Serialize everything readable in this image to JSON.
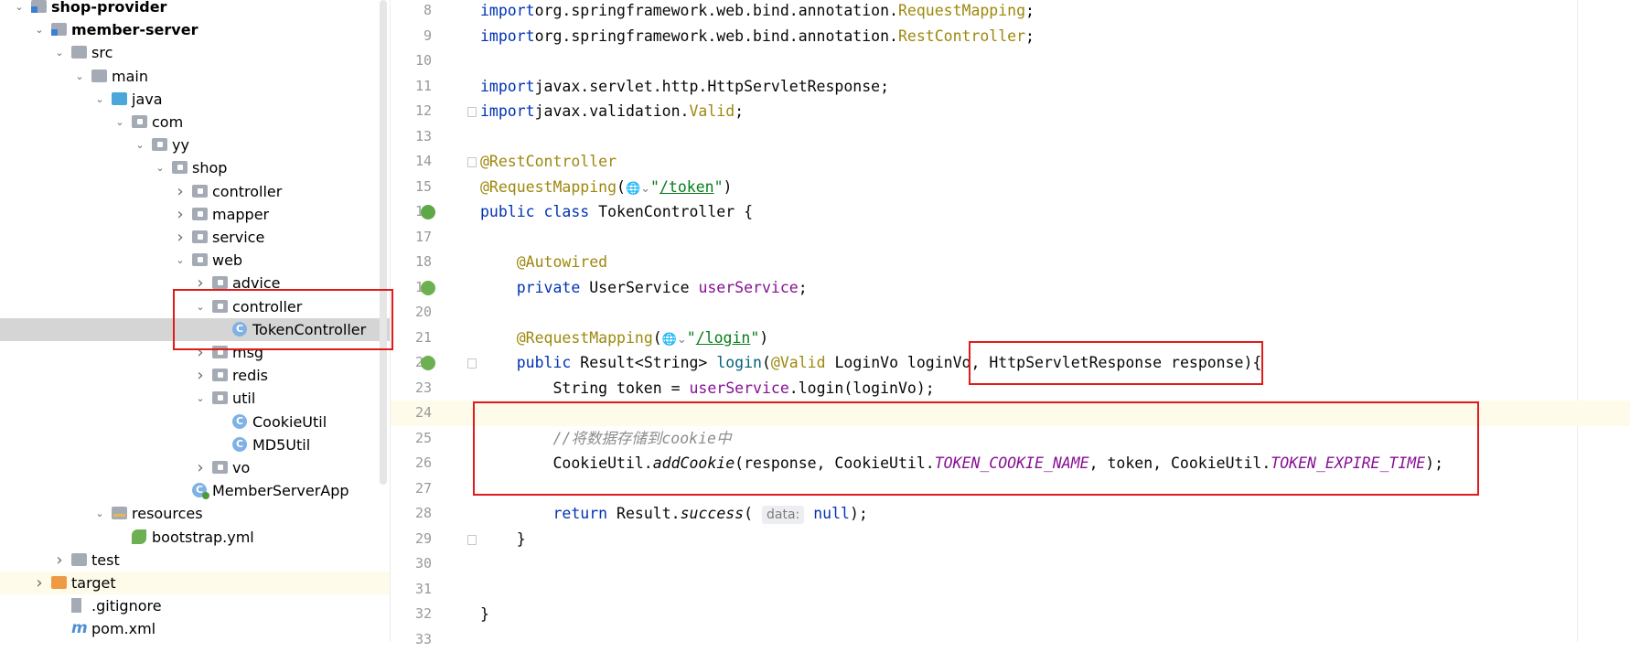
{
  "project_tree": {
    "items": [
      {
        "label": "shop-provider",
        "icon": "module-folder-icon",
        "arrow": "expanded",
        "bold": true
      },
      {
        "label": "member-server",
        "icon": "module-folder-icon",
        "arrow": "expanded",
        "bold": true
      },
      {
        "label": "src",
        "icon": "folder-icon",
        "arrow": "expanded"
      },
      {
        "label": "main",
        "icon": "folder-icon",
        "arrow": "expanded"
      },
      {
        "label": "java",
        "icon": "source-folder-icon",
        "arrow": "expanded"
      },
      {
        "label": "com",
        "icon": "package-icon",
        "arrow": "expanded"
      },
      {
        "label": "yy",
        "icon": "package-icon",
        "arrow": "expanded"
      },
      {
        "label": "shop",
        "icon": "package-icon",
        "arrow": "expanded"
      },
      {
        "label": "controller",
        "icon": "package-icon",
        "arrow": "collapsed"
      },
      {
        "label": "mapper",
        "icon": "package-icon",
        "arrow": "collapsed"
      },
      {
        "label": "service",
        "icon": "package-icon",
        "arrow": "collapsed"
      },
      {
        "label": "web",
        "icon": "package-icon",
        "arrow": "expanded"
      },
      {
        "label": "advice",
        "icon": "package-icon",
        "arrow": "collapsed"
      },
      {
        "label": "controller",
        "icon": "package-icon",
        "arrow": "expanded"
      },
      {
        "label": "TokenController",
        "icon": "class-icon",
        "arrow": "none",
        "selected": true
      },
      {
        "label": "msg",
        "icon": "package-icon",
        "arrow": "collapsed"
      },
      {
        "label": "redis",
        "icon": "package-icon",
        "arrow": "collapsed"
      },
      {
        "label": "util",
        "icon": "package-icon",
        "arrow": "expanded"
      },
      {
        "label": "CookieUtil",
        "icon": "class-icon",
        "arrow": "none"
      },
      {
        "label": "MD5Util",
        "icon": "class-icon",
        "arrow": "none"
      },
      {
        "label": "vo",
        "icon": "package-icon",
        "arrow": "collapsed"
      },
      {
        "label": "MemberServerApp",
        "icon": "spring-boot-app-icon",
        "arrow": "none"
      },
      {
        "label": "resources",
        "icon": "resources-folder-icon",
        "arrow": "expanded"
      },
      {
        "label": "bootstrap.yml",
        "icon": "yaml-icon",
        "arrow": "none"
      },
      {
        "label": "test",
        "icon": "folder-icon",
        "arrow": "collapsed"
      },
      {
        "label": "target",
        "icon": "excluded-folder-icon",
        "arrow": "collapsed",
        "highlight": true
      },
      {
        "label": ".gitignore",
        "icon": "gitignore-icon",
        "arrow": "none"
      },
      {
        "label": "pom.xml",
        "icon": "maven-icon",
        "arrow": "none"
      }
    ]
  },
  "editor": {
    "lines": [
      {
        "n": "8",
        "tokens": [
          [
            "kw",
            "import"
          ],
          [
            "",
            "org.springframework.web.bind.annotation."
          ],
          [
            "ann",
            "RequestMapping"
          ],
          [
            "",
            ";"
          ]
        ]
      },
      {
        "n": "9",
        "tokens": [
          [
            "kw",
            "import"
          ],
          [
            "",
            "org.springframework.web.bind.annotation."
          ],
          [
            "ann",
            "RestController"
          ],
          [
            "",
            ";"
          ]
        ]
      },
      {
        "n": "10",
        "tokens": []
      },
      {
        "n": "11",
        "tokens": [
          [
            "kw",
            "import"
          ],
          [
            "",
            "javax.servlet.http.HttpServletResponse;"
          ]
        ]
      },
      {
        "n": "12",
        "tokens": [
          [
            "kw",
            "import"
          ],
          [
            "",
            "javax.validation."
          ],
          [
            "ann",
            "Valid"
          ],
          [
            "",
            ";"
          ]
        ],
        "fold": true
      },
      {
        "n": "13",
        "tokens": []
      },
      {
        "n": "14",
        "tokens": [
          [
            "ann",
            "@RestController"
          ]
        ],
        "fold": true
      },
      {
        "n": "15",
        "tokens": [
          [
            "ann",
            "@RequestMapping"
          ],
          [
            "",
            "("
          ],
          [
            "globe",
            "🌐⌄"
          ],
          [
            "str",
            "\""
          ],
          [
            "str url",
            "/token"
          ],
          [
            "str",
            "\""
          ],
          [
            "",
            ")"
          ]
        ]
      },
      {
        "n": "16",
        "tokens": [
          [
            "kw",
            "public class"
          ],
          [
            "",
            " TokenController {"
          ]
        ],
        "gutter": "bean-icon"
      },
      {
        "n": "17",
        "tokens": []
      },
      {
        "n": "18",
        "tokens": [
          [
            "",
            "    "
          ],
          [
            "ann",
            "@Autowired"
          ]
        ]
      },
      {
        "n": "19",
        "tokens": [
          [
            "",
            "    "
          ],
          [
            "kw",
            "private"
          ],
          [
            "",
            " UserService "
          ],
          [
            "field",
            "userService"
          ],
          [
            "",
            ";"
          ]
        ],
        "gutter": "autowired-icon"
      },
      {
        "n": "20",
        "tokens": []
      },
      {
        "n": "21",
        "tokens": [
          [
            "",
            "    "
          ],
          [
            "ann",
            "@RequestMapping"
          ],
          [
            "",
            "("
          ],
          [
            "globe",
            "🌐⌄"
          ],
          [
            "str",
            "\""
          ],
          [
            "str url",
            "/login"
          ],
          [
            "str",
            "\""
          ],
          [
            "",
            ")"
          ]
        ]
      },
      {
        "n": "22",
        "tokens": [
          [
            "",
            "    "
          ],
          [
            "kw",
            "public"
          ],
          [
            "",
            " Result<String> "
          ],
          [
            "meth",
            "login"
          ],
          [
            "",
            "("
          ],
          [
            "ann",
            "@Valid"
          ],
          [
            "",
            " LoginVo loginVo, HttpServletResponse response){"
          ]
        ],
        "gutter": "request-mapping-icon",
        "fold": true
      },
      {
        "n": "23",
        "tokens": [
          [
            "",
            "        String token = "
          ],
          [
            "field",
            "userService"
          ],
          [
            "",
            ".login(loginVo);"
          ]
        ]
      },
      {
        "n": "24",
        "tokens": [],
        "caret": true
      },
      {
        "n": "25",
        "tokens": [
          [
            "",
            "        "
          ],
          [
            "cmt",
            "//将数据存储到cookie中"
          ]
        ]
      },
      {
        "n": "26",
        "tokens": [
          [
            "",
            "        CookieUtil."
          ],
          [
            "static",
            "addCookie"
          ],
          [
            "",
            "(response, CookieUtil."
          ],
          [
            "const",
            "TOKEN_COOKIE_NAME"
          ],
          [
            "",
            ", token, CookieUtil."
          ],
          [
            "const",
            "TOKEN_EXPIRE_TIME"
          ],
          [
            "",
            ");"
          ]
        ]
      },
      {
        "n": "27",
        "tokens": []
      },
      {
        "n": "28",
        "tokens": [
          [
            "",
            "        "
          ],
          [
            "kw",
            "return"
          ],
          [
            "",
            " Result."
          ],
          [
            "static",
            "success"
          ],
          [
            "",
            "( "
          ],
          [
            "hint",
            "data:"
          ],
          [
            "",
            " "
          ],
          [
            "kw",
            "null"
          ],
          [
            "",
            ");"
          ]
        ]
      },
      {
        "n": "29",
        "tokens": [
          [
            "",
            "    }"
          ]
        ],
        "fold": true
      },
      {
        "n": "30",
        "tokens": []
      },
      {
        "n": "31",
        "tokens": []
      },
      {
        "n": "32",
        "tokens": [
          [
            "",
            "}"
          ]
        ]
      },
      {
        "n": "33",
        "tokens": []
      }
    ]
  },
  "colors": {
    "annotation_box": "#e11a1a",
    "selection": "#d5d5d5",
    "caret_line": "#fefbea"
  }
}
